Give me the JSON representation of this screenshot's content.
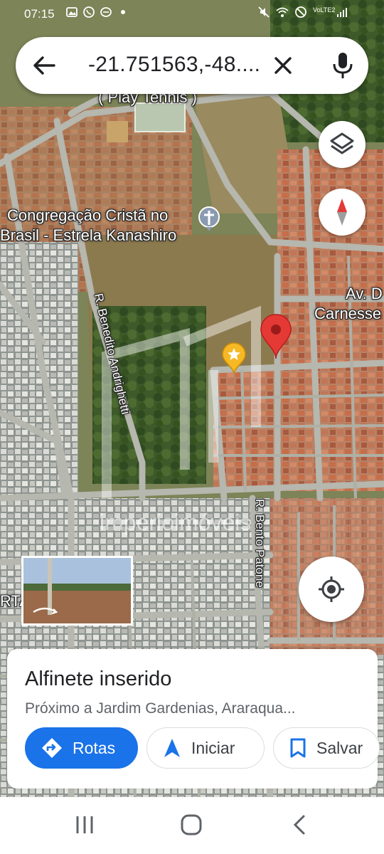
{
  "status_bar": {
    "time": "07:15",
    "left_icons": [
      "image-icon",
      "whatsapp-icon",
      "app-notification-icon",
      "dot-icon"
    ],
    "right_icons": [
      "mute-icon",
      "wifi-icon",
      "dnd-icon",
      "volte-icon",
      "signal-icon"
    ],
    "volte_label": "VoLTE2"
  },
  "search": {
    "query": "-21.751563,-48...."
  },
  "map": {
    "labels": {
      "tennis": "( Play Tennis )",
      "church_line1": "Congregação Cristã no",
      "church_line2": "Brasil - Estrela Kanashiro",
      "avenue_line1": "Av. D",
      "avenue_line2": "Carnesse",
      "street_benedito": "R. Benedito Andrighetti",
      "street_bento": "R. Bento Patone",
      "left_fragment": "RTA",
      "watermark": "imperioimóveis"
    }
  },
  "place_card": {
    "title": "Alfinete inserido",
    "subtitle": "Próximo a Jardim Gardenias, Araraqua...",
    "actions": {
      "rotas": "Rotas",
      "iniciar": "Iniciar",
      "salvar": "Salvar"
    }
  },
  "colors": {
    "accent_blue": "#1a73e8",
    "pin_red": "#e53935",
    "star_yellow": "#f6b824"
  }
}
